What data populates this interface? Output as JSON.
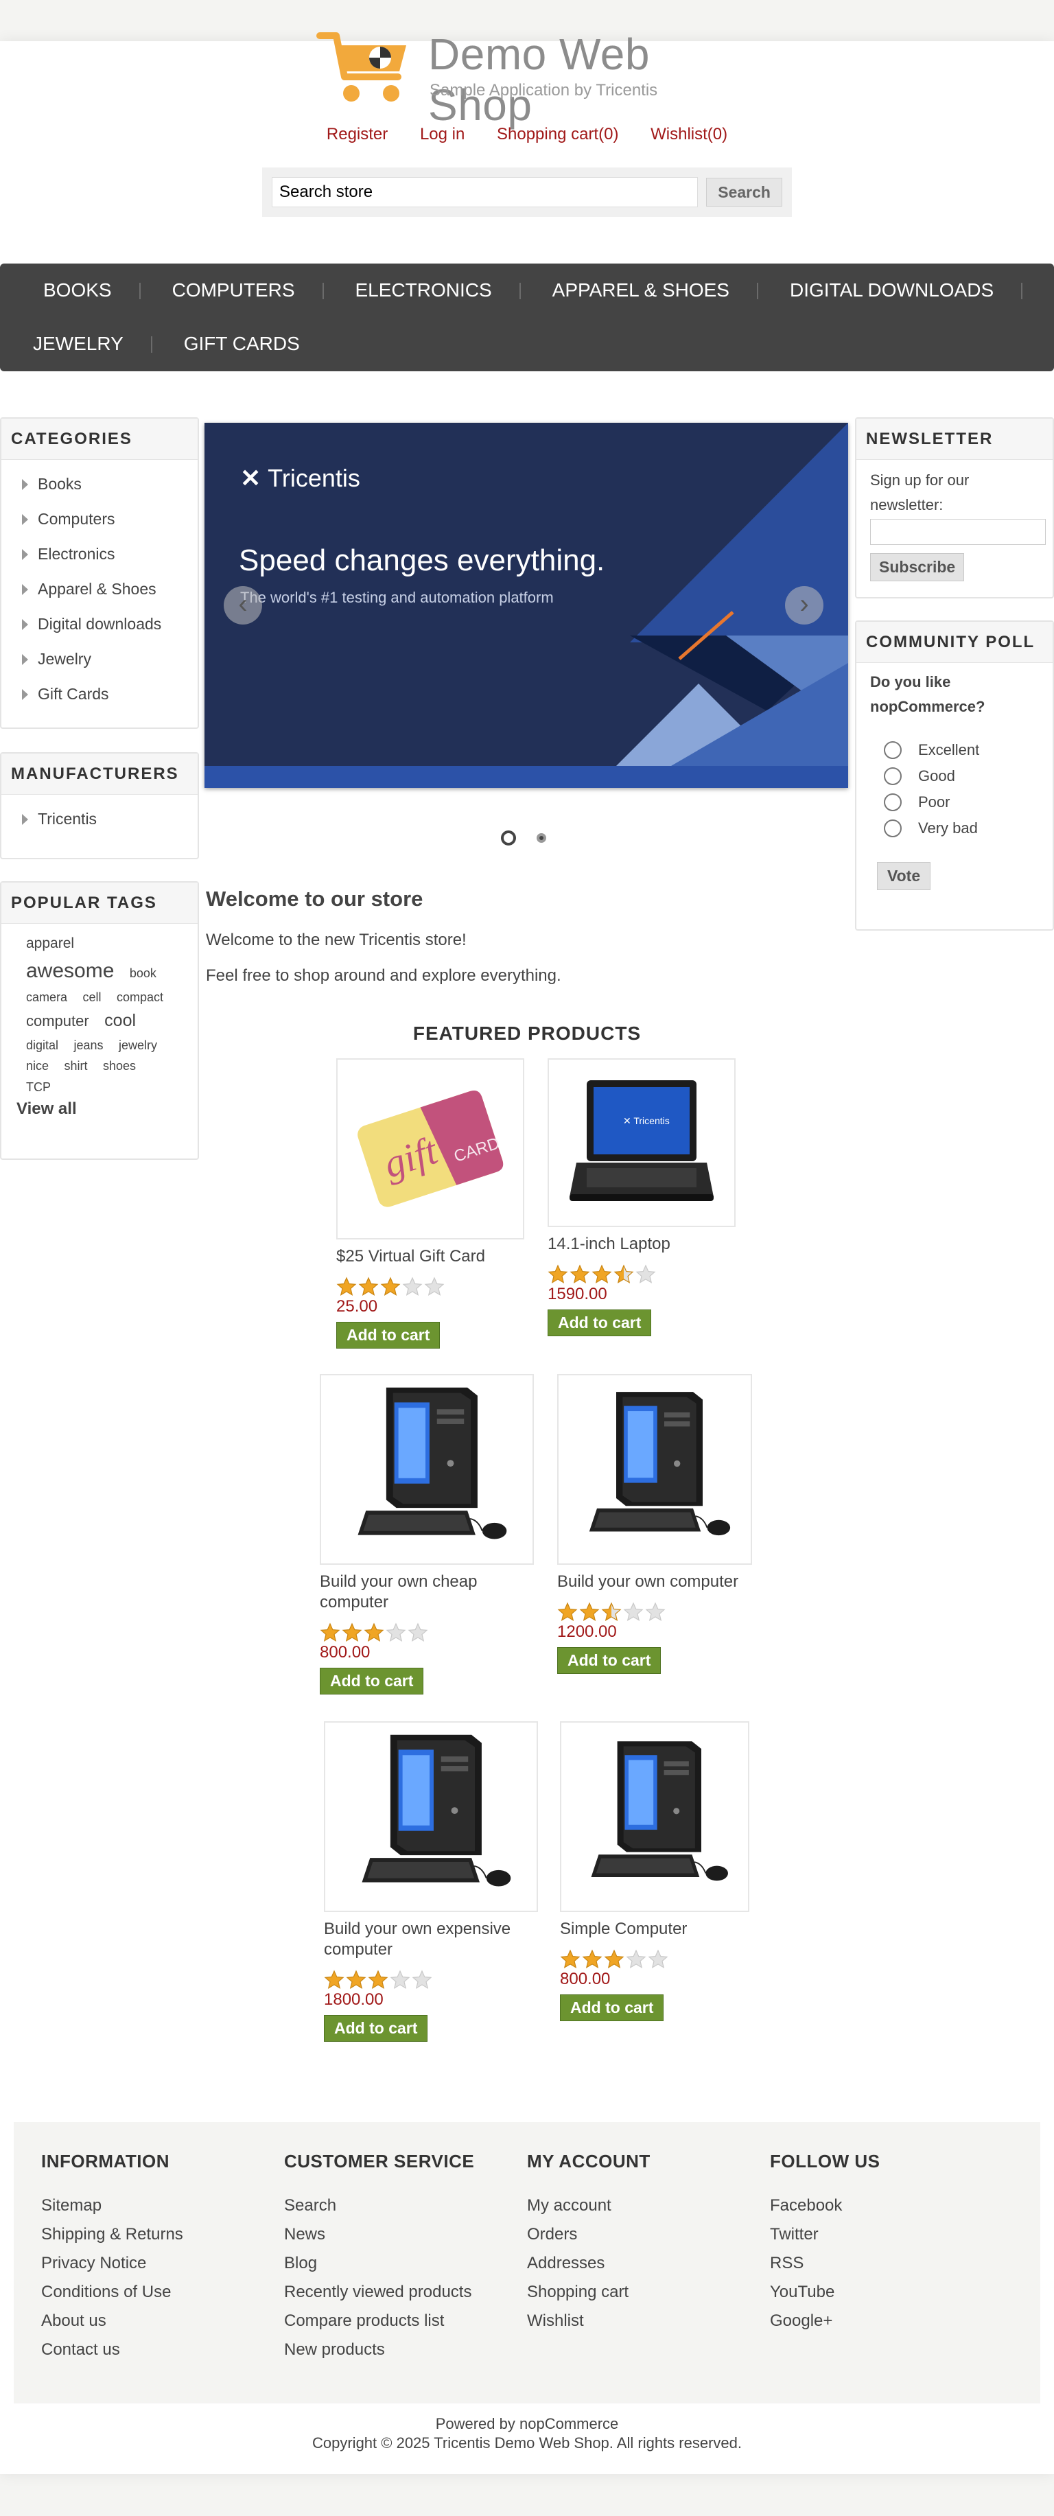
{
  "header": {
    "logo_title": "Demo Web Shop",
    "logo_subtitle": "Sample Application by Tricentis",
    "links": [
      "Register",
      "Log in",
      "Shopping cart(0)",
      "Wishlist(0)"
    ],
    "search_placeholder": "Search store",
    "search_value": "Search store",
    "search_button": "Search"
  },
  "top_menu": {
    "row1": [
      "BOOKS",
      "COMPUTERS",
      "ELECTRONICS",
      "APPAREL & SHOES",
      "DIGITAL DOWNLOADS"
    ],
    "row2": [
      "JEWELRY",
      "GIFT CARDS"
    ]
  },
  "categories": {
    "title": "CATEGORIES",
    "items": [
      "Books",
      "Computers",
      "Electronics",
      "Apparel & Shoes",
      "Digital downloads",
      "Jewelry",
      "Gift Cards"
    ]
  },
  "manufacturers": {
    "title": "MANUFACTURERS",
    "items": [
      "Tricentis"
    ]
  },
  "popular_tags": {
    "title": "POPULAR TAGS",
    "tags": [
      "apparel",
      "awesome",
      "book",
      "camera",
      "cell",
      "compact",
      "computer",
      "cool",
      "digital",
      "jeans",
      "jewelry",
      "nice",
      "shirt",
      "shoes",
      "TCP"
    ],
    "view_all": "View all"
  },
  "slider": {
    "brand": "Tricentis",
    "headline": "Speed changes everything.",
    "subline": "The world's #1 testing and automation platform",
    "colors": {
      "bg": "#223057",
      "accent": "#e8772e"
    }
  },
  "welcome": {
    "title": "Welcome to our store",
    "line1": "Welcome to the new Tricentis store!",
    "line2": "Feel free to shop around and explore everything."
  },
  "featured": {
    "title": "FEATURED PRODUCTS",
    "add_to_cart": "Add to cart",
    "products": [
      {
        "name": "$25 Virtual Gift Card",
        "price": "25.00",
        "rating": 3,
        "image": "gift-card"
      },
      {
        "name": "14.1-inch Laptop",
        "price": "1590.00",
        "rating": 3.5,
        "image": "laptop"
      },
      {
        "name": "Build your own cheap computer",
        "price": "800.00",
        "rating": 3,
        "image": "desktop"
      },
      {
        "name": "Build your own computer",
        "price": "1200.00",
        "rating": 2.5,
        "image": "desktop"
      },
      {
        "name": "Build your own expensive computer",
        "price": "1800.00",
        "rating": 3,
        "image": "desktop"
      },
      {
        "name": "Simple Computer",
        "price": "800.00",
        "rating": 3,
        "image": "desktop"
      }
    ]
  },
  "newsletter": {
    "title": "NEWSLETTER",
    "text": "Sign up for our newsletter:",
    "button": "Subscribe"
  },
  "poll": {
    "title": "COMMUNITY POLL",
    "question": "Do you like nopCommerce?",
    "options": [
      "Excellent",
      "Good",
      "Poor",
      "Very bad"
    ],
    "button": "Vote"
  },
  "footer": {
    "columns": [
      {
        "title": "INFORMATION",
        "links": [
          "Sitemap",
          "Shipping & Returns",
          "Privacy Notice",
          "Conditions of Use",
          "About us",
          "Contact us"
        ]
      },
      {
        "title": "CUSTOMER SERVICE",
        "links": [
          "Search",
          "News",
          "Blog",
          "Recently viewed products",
          "Compare products list",
          "New products"
        ]
      },
      {
        "title": "MY ACCOUNT",
        "links": [
          "My account",
          "Orders",
          "Addresses",
          "Shopping cart",
          "Wishlist"
        ]
      },
      {
        "title": "FOLLOW US",
        "links": [
          "Facebook",
          "Twitter",
          "RSS",
          "YouTube",
          "Google+"
        ]
      }
    ],
    "powered_by": "Powered by nopCommerce",
    "copyright": "Copyright © 2025 Tricentis Demo Web Shop. All rights reserved."
  },
  "colors": {
    "link_red": "#a11919",
    "menu_bg": "#444444",
    "add_to_cart_green": "#6c9430",
    "star_gold": "#f0a524"
  }
}
